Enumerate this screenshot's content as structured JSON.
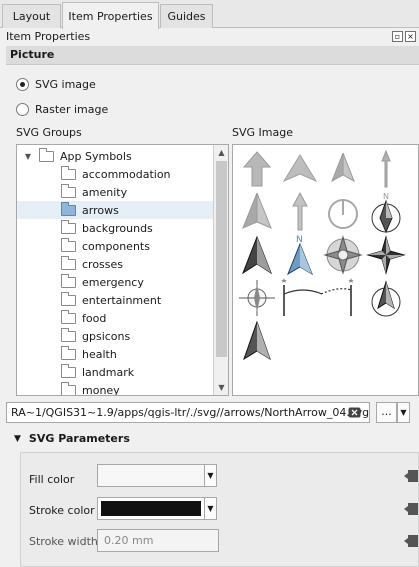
{
  "tabs": [
    {
      "label": "Layout",
      "active": false
    },
    {
      "label": "Item Properties",
      "active": true
    },
    {
      "label": "Guides",
      "active": false
    }
  ],
  "dock": {
    "title": "Item Properties"
  },
  "section": {
    "title": "Picture"
  },
  "source": {
    "svg_label": "SVG image",
    "raster_label": "Raster image",
    "selected": "svg"
  },
  "groups": {
    "label": "SVG Groups",
    "root": "App Symbols",
    "items": [
      "accommodation",
      "amenity",
      "arrows",
      "backgrounds",
      "components",
      "crosses",
      "emergency",
      "entertainment",
      "food",
      "gpsicons",
      "health",
      "landmark",
      "money"
    ],
    "selected": "arrows"
  },
  "images": {
    "label": "SVG Image",
    "icons": [
      "arrow-up-thick-icon",
      "arrow-head-icon",
      "arrow-head-half-icon",
      "arrow-thin-up-icon",
      "arrow-tall-half-icon",
      "arrow-thin-shaft-icon",
      "north-circle-icon",
      "north-arrow-star-icon",
      "north-arrow-dark-icon",
      "north-arrow-blue-icon",
      "compass-rose-icon",
      "four-point-star-icon",
      "compass-cross-icon",
      "north-arc-icon",
      "north-arc-dotted-icon",
      "north-arrow-circle-icon",
      "north-arrow-plain-icon"
    ]
  },
  "path": {
    "value": "RA~1/QGIS31~1.9/apps/qgis-ltr/./svg//arrows/NorthArrow_04.svg",
    "browse_label": "..."
  },
  "params": {
    "title": "SVG Parameters",
    "fill_label": "Fill color",
    "fill_color": "#f7f7f7",
    "stroke_label": "Stroke color",
    "stroke_color": "#111111",
    "width_label": "Stroke width",
    "width_value": "0.20 mm"
  }
}
